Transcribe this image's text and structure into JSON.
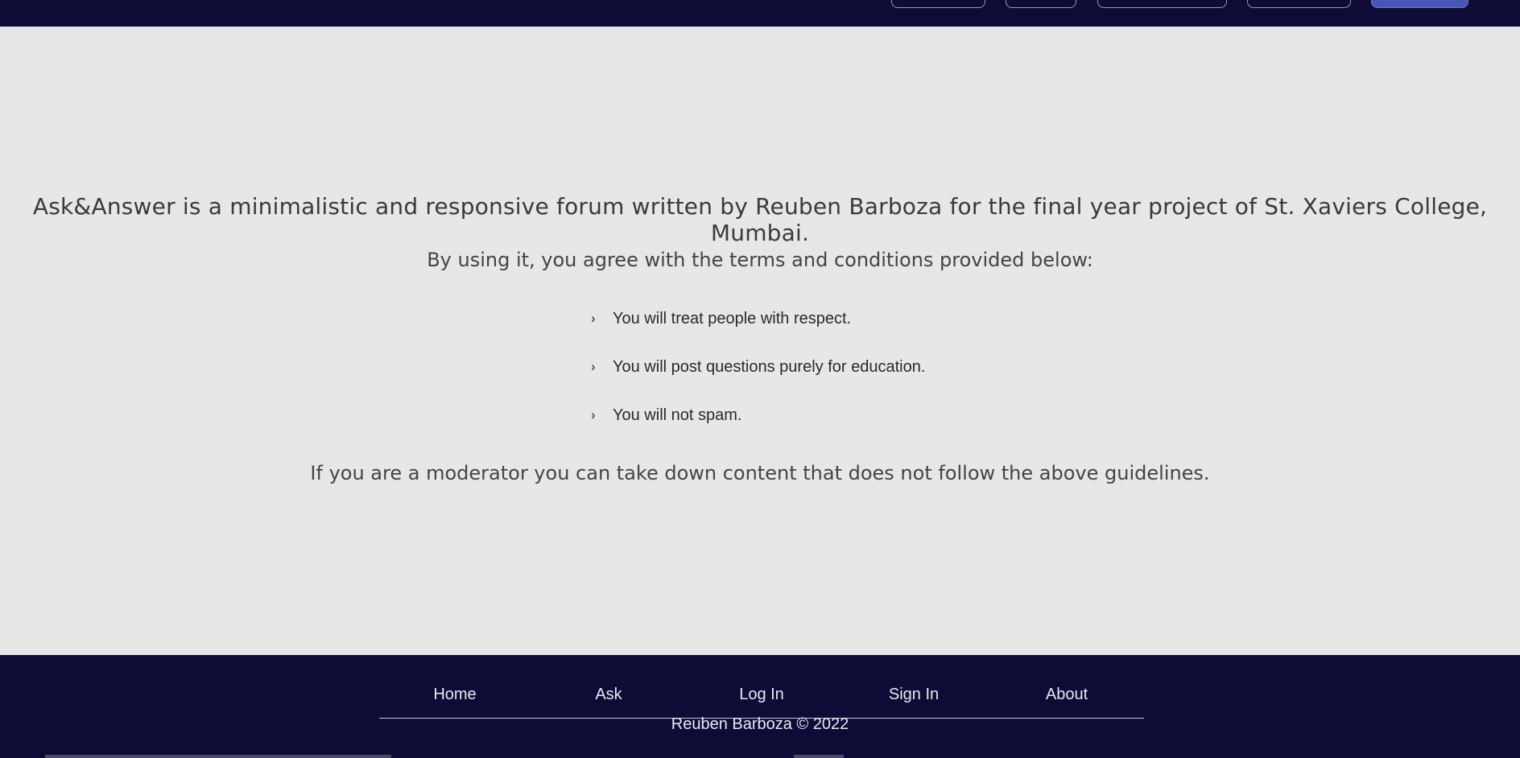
{
  "main": {
    "headline": "Ask&Answer is a minimalistic and responsive forum written by Reuben Barboza for the final year project of St. Xaviers College, Mumbai.",
    "subline": "By using it, you agree with the terms and conditions provided below:",
    "rules": [
      "You will treat people with respect.",
      "You will post questions purely for education.",
      "You will not spam."
    ],
    "rule_bullet": "chevron-right-icon",
    "closing": "If you are a moderator you can take down content that does not follow the above guidelines."
  },
  "footer": {
    "nav": [
      {
        "label": "Home"
      },
      {
        "label": "Ask"
      },
      {
        "label": "Log In"
      },
      {
        "label": "Sign In"
      },
      {
        "label": "About"
      }
    ],
    "copyright": "Reuben Barboza © 2022"
  },
  "colors": {
    "header_bg": "#0e0b37",
    "page_bg": "#e7e7e7",
    "footer_bg": "#0e0b37",
    "primary_button": "#4a55b8"
  }
}
